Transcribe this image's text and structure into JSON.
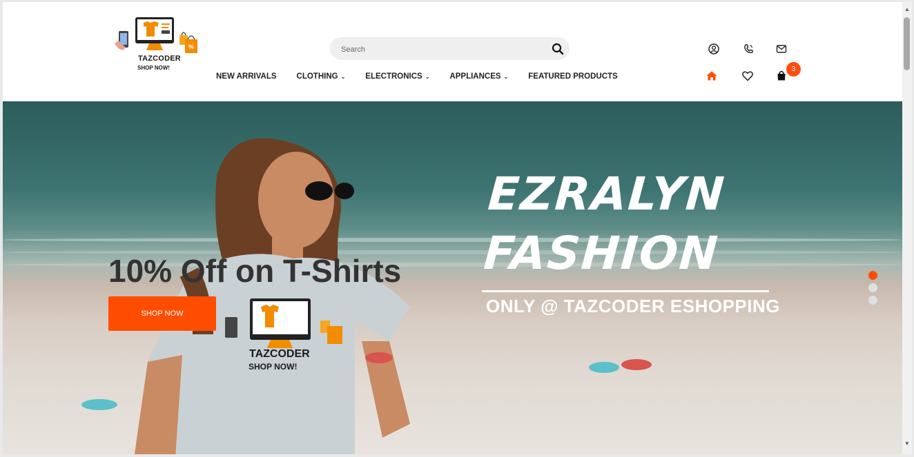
{
  "brand": {
    "name": "TAZCODER",
    "tagline": "SHOP NOW!",
    "accent": "#ff4d00"
  },
  "search": {
    "placeholder": "Search",
    "icon": "search-icon"
  },
  "nav": {
    "items": [
      {
        "label": "NEW ARRIVALS",
        "dropdown": false
      },
      {
        "label": "CLOTHING",
        "dropdown": true
      },
      {
        "label": "ELECTRONICS",
        "dropdown": true
      },
      {
        "label": "APPLIANCES",
        "dropdown": true
      },
      {
        "label": "FEATURED PRODUCTS",
        "dropdown": false
      }
    ]
  },
  "header_icons": {
    "top": [
      "user-icon",
      "phone-icon",
      "mail-icon"
    ],
    "bottom": [
      "home-icon",
      "heart-icon",
      "cart-icon"
    ],
    "cart_count": "3"
  },
  "hero": {
    "brand_title_line1": "EZRALYN",
    "brand_title_line2": "FASHION",
    "brand_subtitle": "ONLY @ TAZCODER ESHOPPING",
    "promo_text": "10% Off on T-Shirts",
    "cta_label": "SHOP NOW",
    "shirt_logo_name": "TAZCODER",
    "shirt_logo_tagline": "SHOP NOW!",
    "slides": 3,
    "active_slide": 1
  }
}
